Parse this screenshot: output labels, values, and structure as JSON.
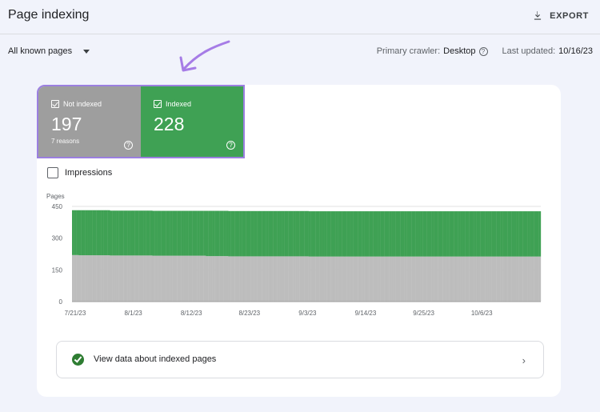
{
  "header": {
    "title": "Page indexing",
    "export_label": "EXPORT",
    "export_icon": "download-icon"
  },
  "filter": {
    "selected": "All known pages",
    "crawler_label": "Primary crawler:",
    "crawler_value": "Desktop",
    "updated_label": "Last updated:",
    "updated_value": "10/16/23"
  },
  "tiles": {
    "not_indexed": {
      "label": "Not indexed",
      "value": "197",
      "sub": "7 reasons",
      "color": "#9e9e9e"
    },
    "indexed": {
      "label": "Indexed",
      "value": "228",
      "color": "#3fa154"
    }
  },
  "impressions_label": "Impressions",
  "annotation": {
    "color": "#a67ce6"
  },
  "chart_data": {
    "type": "bar",
    "stacked": true,
    "ylabel": "Pages",
    "ylim": [
      0,
      450
    ],
    "yticks": [
      "450",
      "300",
      "150",
      "0"
    ],
    "xtick_labels": [
      "7/21/23",
      "8/1/23",
      "8/12/23",
      "8/23/23",
      "9/3/23",
      "9/14/23",
      "9/25/23",
      "10/6/23"
    ],
    "grid": true,
    "series": [
      {
        "key": "not_indexed",
        "color": "#bdbdbd",
        "values": [
          220,
          220,
          220,
          219,
          219,
          219,
          219,
          219,
          219,
          219,
          219,
          219,
          219,
          219,
          219,
          219,
          219,
          218,
          218,
          218,
          218,
          218,
          218,
          218,
          218,
          218,
          218,
          218,
          218,
          218,
          218,
          218,
          218,
          218,
          218,
          218,
          217,
          217,
          217,
          217,
          217,
          217,
          217,
          217,
          217,
          217,
          217,
          217,
          217,
          217,
          217,
          217,
          217,
          217,
          217,
          217,
          217,
          217,
          217,
          217,
          215,
          215,
          215,
          215,
          215,
          215,
          215,
          215,
          215,
          215,
          214,
          214,
          214,
          214,
          214,
          214,
          214,
          214,
          214,
          214,
          214,
          214,
          214,
          214,
          214,
          214,
          214,
          214,
          214,
          214,
          214,
          214,
          214,
          214,
          214,
          214,
          214,
          214,
          214,
          214,
          214,
          214,
          214,
          214,
          214,
          214,
          213,
          213,
          213,
          213,
          213,
          213,
          213,
          213,
          213,
          213,
          213,
          213,
          213,
          213,
          213,
          213,
          213,
          213,
          213,
          213,
          213,
          213,
          213,
          213,
          213,
          213,
          213,
          213,
          213,
          213,
          213,
          213,
          213,
          213,
          213,
          213,
          213,
          213,
          213,
          213,
          213,
          213,
          213,
          213,
          213,
          213,
          213,
          213,
          213,
          213,
          213,
          213,
          213,
          213,
          213,
          213,
          213,
          213,
          213,
          213,
          213,
          213,
          213,
          213,
          213,
          213,
          213,
          213,
          213,
          213,
          213,
          213,
          213,
          213,
          213,
          213,
          213,
          213,
          213,
          213,
          213,
          213,
          213,
          213,
          213,
          213,
          213,
          213,
          213,
          213,
          213,
          213,
          213,
          213,
          213,
          213,
          213,
          213,
          213,
          213,
          213,
          213,
          213,
          213
        ]
      },
      {
        "key": "indexed",
        "color": "#3fa154",
        "values": [
          212,
          212,
          212,
          213,
          213,
          213,
          213,
          213,
          213,
          213,
          213,
          213,
          213,
          213,
          213,
          213,
          213,
          212,
          212,
          212,
          212,
          212,
          212,
          212,
          212,
          212,
          212,
          212,
          212,
          212,
          212,
          212,
          212,
          212,
          212,
          212,
          212,
          212,
          212,
          212,
          212,
          212,
          212,
          212,
          212,
          212,
          212,
          212,
          212,
          212,
          212,
          212,
          212,
          212,
          212,
          212,
          212,
          212,
          212,
          212,
          214,
          214,
          214,
          214,
          214,
          214,
          214,
          214,
          214,
          214,
          214,
          214,
          214,
          214,
          214,
          214,
          214,
          214,
          214,
          214,
          214,
          214,
          214,
          214,
          214,
          214,
          214,
          214,
          214,
          214,
          214,
          214,
          214,
          214,
          214,
          214,
          214,
          214,
          214,
          214,
          214,
          214,
          214,
          214,
          214,
          214,
          214,
          214,
          214,
          214,
          214,
          214,
          214,
          214,
          214,
          214,
          214,
          214,
          214,
          214,
          214,
          214,
          214,
          214,
          214,
          214,
          214,
          214,
          214,
          214,
          214,
          214,
          214,
          214,
          214,
          214,
          214,
          214,
          214,
          214,
          214,
          214,
          214,
          214,
          214,
          214,
          214,
          214,
          214,
          214,
          214,
          214,
          214,
          214,
          214,
          214,
          214,
          214,
          214,
          214,
          214,
          214,
          214,
          214,
          214,
          214,
          214,
          214,
          214,
          214,
          214,
          214,
          214,
          214,
          214,
          214,
          214,
          214,
          214,
          214,
          214,
          214,
          214,
          214,
          214,
          214,
          214,
          214,
          214,
          214,
          214,
          214,
          214,
          214,
          214,
          214,
          214,
          214,
          214,
          214,
          214,
          214,
          214,
          214,
          214,
          214,
          214,
          214,
          214,
          214,
          214
        ]
      }
    ]
  },
  "view_data_label": "View data about indexed pages"
}
